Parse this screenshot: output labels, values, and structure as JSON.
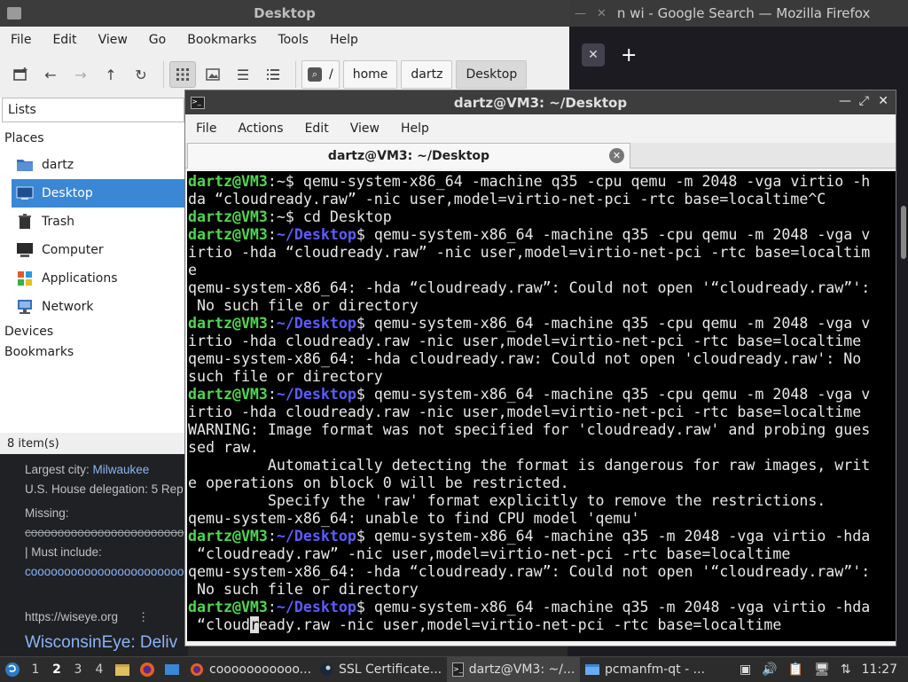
{
  "firefox": {
    "title": "n wi - Google Search — Mozilla Firefox",
    "tab_close": "✕",
    "new_tab": "+"
  },
  "filemanager": {
    "title": "Desktop",
    "menu": [
      "File",
      "Edit",
      "View",
      "Go",
      "Bookmarks",
      "Tools",
      "Help"
    ],
    "path": [
      "/",
      "home",
      "dartz",
      "Desktop"
    ],
    "side_combo": "Lists",
    "places_header": "Places",
    "places": [
      "dartz",
      "Desktop",
      "Trash",
      "Computer",
      "Applications",
      "Network"
    ],
    "devices": "Devices",
    "bookmarks": "Bookmarks",
    "status": "8 item(s)"
  },
  "webpage": {
    "largest_city_label": "Largest city: ",
    "largest_city": "Milwaukee",
    "house_delegation": "U.S. House delegation: 5 Rep",
    "missing_label": "Missing:",
    "missing_value": "cooooooooooooooooooooooo",
    "must_include_label": "| Must include:",
    "must_include_value": "cooooooooooooooooooooooo",
    "site_url": "https://wiseye.org",
    "site_menu": "⋮",
    "site_title": "WisconsinEye: Deliv"
  },
  "terminal": {
    "title": "dartz@VM3: ~/Desktop",
    "tab_title": "dartz@VM3: ~/Desktop",
    "menu": [
      "File",
      "Actions",
      "Edit",
      "View",
      "Help"
    ],
    "lines": [
      [
        {
          "t": "dartz@VM3",
          "c": "user"
        },
        {
          "t": ":~$ qemu-system-x86_64 -machine q35 -cpu qemu -m 2048 -vga virtio -h"
        }
      ],
      [
        {
          "t": "da “cloudready.raw” -nic user,model=virtio-net-pci -rtc base=localtime^C"
        }
      ],
      [
        {
          "t": "dartz@VM3",
          "c": "user"
        },
        {
          "t": ":~$ cd Desktop"
        }
      ],
      [
        {
          "t": "dartz@VM3",
          "c": "user"
        },
        {
          "t": ":"
        },
        {
          "t": "~/Desktop",
          "c": "path"
        },
        {
          "t": "$ qemu-system-x86_64 -machine q35 -cpu qemu -m 2048 -vga v"
        }
      ],
      [
        {
          "t": "irtio -hda “cloudready.raw” -nic user,model=virtio-net-pci -rtc base=localtim"
        }
      ],
      [
        {
          "t": "e"
        }
      ],
      [
        {
          "t": "qemu-system-x86_64: -hda “cloudready.raw”: Could not open '“cloudready.raw”':"
        }
      ],
      [
        {
          "t": " No such file or directory"
        }
      ],
      [
        {
          "t": "dartz@VM3",
          "c": "user"
        },
        {
          "t": ":"
        },
        {
          "t": "~/Desktop",
          "c": "path"
        },
        {
          "t": "$ qemu-system-x86_64 -machine q35 -cpu qemu -m 2048 -vga v"
        }
      ],
      [
        {
          "t": "irtio -hda cloudready.raw -nic user,model=virtio-net-pci -rtc base=localtime"
        }
      ],
      [
        {
          "t": "qemu-system-x86_64: -hda cloudready.raw: Could not open 'cloudready.raw': No"
        }
      ],
      [
        {
          "t": "such file or directory"
        }
      ],
      [
        {
          "t": "dartz@VM3",
          "c": "user"
        },
        {
          "t": ":"
        },
        {
          "t": "~/Desktop",
          "c": "path"
        },
        {
          "t": "$ qemu-system-x86_64 -machine q35 -cpu qemu -m 2048 -vga v"
        }
      ],
      [
        {
          "t": "irtio -hda cloudready.raw -nic user,model=virtio-net-pci -rtc base=localtime"
        }
      ],
      [
        {
          "t": "WARNING: Image format was not specified for 'cloudready.raw' and probing gues"
        }
      ],
      [
        {
          "t": "sed raw."
        }
      ],
      [
        {
          "t": "         Automatically detecting the format is dangerous for raw images, writ"
        }
      ],
      [
        {
          "t": "e operations on block 0 will be restricted."
        }
      ],
      [
        {
          "t": "         Specify the 'raw' format explicitly to remove the restrictions."
        }
      ],
      [
        {
          "t": "qemu-system-x86_64: unable to find CPU model 'qemu'"
        }
      ],
      [
        {
          "t": "dartz@VM3",
          "c": "user"
        },
        {
          "t": ":"
        },
        {
          "t": "~/Desktop",
          "c": "path"
        },
        {
          "t": "$ qemu-system-x86_64 -machine q35 -m 2048 -vga virtio -hda"
        }
      ],
      [
        {
          "t": " “cloudready.raw” -nic user,model=virtio-net-pci -rtc base=localtime"
        }
      ],
      [
        {
          "t": "qemu-system-x86_64: -hda “cloudready.raw”: Could not open '“cloudready.raw”':"
        }
      ],
      [
        {
          "t": " No such file or directory"
        }
      ],
      [
        {
          "t": "dartz@VM3",
          "c": "user"
        },
        {
          "t": ":"
        },
        {
          "t": "~/Desktop",
          "c": "path"
        },
        {
          "t": "$ qemu-system-x86_64 -machine q35 -m 2048 -vga virtio -hda"
        }
      ],
      [
        {
          "t": " “cloud"
        },
        {
          "t": "r",
          "c": "cursor"
        },
        {
          "t": "eady.raw -nic user,model=virtio-net-pci -rtc base=localtime"
        }
      ]
    ]
  },
  "taskbar": {
    "workspaces": [
      "1",
      "2",
      "3",
      "4"
    ],
    "active_workspace": "2",
    "tasks": [
      {
        "label": "cooooooooooo...",
        "icon": "firefox-icon"
      },
      {
        "label": "SSL Certificate...",
        "icon": "steam-icon"
      },
      {
        "label": "dartz@VM3: ~/...",
        "icon": "terminal-icon",
        "active": true
      },
      {
        "label": "pcmanfm-qt - ...",
        "icon": "folder-icon"
      }
    ],
    "clock": "11:27"
  }
}
